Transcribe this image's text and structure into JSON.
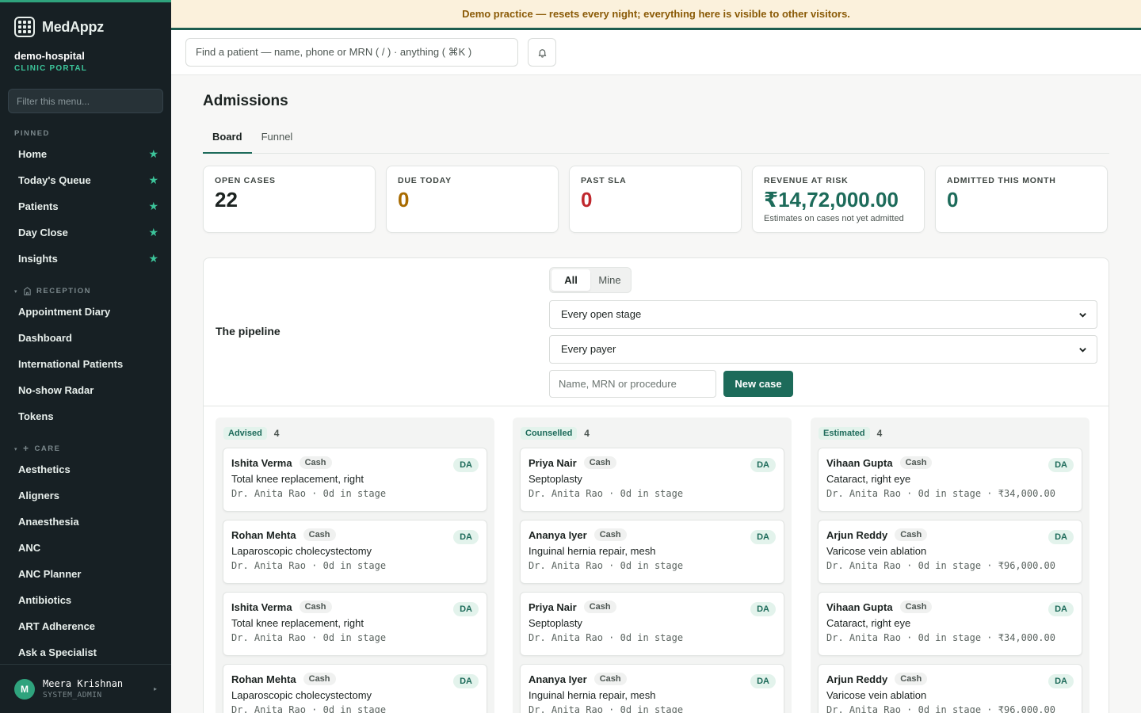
{
  "brand": {
    "name": "MedAppz"
  },
  "org": {
    "name": "demo-hospital",
    "portal": "CLINIC PORTAL"
  },
  "sidebar": {
    "filter_placeholder": "Filter this menu...",
    "pinned_label": "PINNED",
    "pinned": [
      {
        "label": "Home"
      },
      {
        "label": "Today's Queue"
      },
      {
        "label": "Patients"
      },
      {
        "label": "Day Close"
      },
      {
        "label": "Insights"
      }
    ],
    "reception_label": "RECEPTION",
    "reception": [
      {
        "label": "Appointment Diary"
      },
      {
        "label": "Dashboard"
      },
      {
        "label": "International Patients"
      },
      {
        "label": "No-show Radar"
      },
      {
        "label": "Tokens"
      }
    ],
    "care_label": "CARE",
    "care": [
      {
        "label": "Aesthetics"
      },
      {
        "label": "Aligners"
      },
      {
        "label": "Anaesthesia"
      },
      {
        "label": "ANC"
      },
      {
        "label": "ANC Planner"
      },
      {
        "label": "Antibiotics"
      },
      {
        "label": "ART Adherence"
      },
      {
        "label": "Ask a Specialist"
      }
    ],
    "user": {
      "initial": "M",
      "name": "Meera Krishnan",
      "role": "SYSTEM_ADMIN"
    }
  },
  "banner": {
    "text": "Demo practice — resets every night; everything here is visible to other visitors."
  },
  "header": {
    "search_placeholder": "Find a patient — name, phone or MRN ( / ) · anything ( ⌘K )"
  },
  "page": {
    "title": "Admissions",
    "tabs": [
      {
        "label": "Board"
      },
      {
        "label": "Funnel"
      }
    ]
  },
  "stats": [
    {
      "label": "OPEN CASES",
      "value": "22",
      "color": "#1c2321"
    },
    {
      "label": "DUE TODAY",
      "value": "0",
      "color": "#a86b00"
    },
    {
      "label": "PAST SLA",
      "value": "0",
      "color": "#c0282e"
    },
    {
      "label": "REVENUE AT RISK",
      "value": "₹14,72,000.00",
      "note": "Estimates on cases not yet admitted",
      "color": "#1d6b5a"
    },
    {
      "label": "ADMITTED THIS MONTH",
      "value": "0",
      "color": "#1d6b5a"
    }
  ],
  "pipeline": {
    "title": "The pipeline",
    "scope_options": [
      {
        "label": "All"
      },
      {
        "label": "Mine"
      }
    ],
    "stage_select": "Every open stage",
    "payer_select": "Every payer",
    "case_search_placeholder": "Name, MRN or procedure",
    "new_case_label": "New case",
    "columns": [
      {
        "stage": "Advised",
        "count": "4",
        "cards": [
          {
            "name": "Ishita Verma",
            "payer": "Cash",
            "badge": "DA",
            "procedure": "Total knee replacement, right",
            "meta": "Dr. Anita Rao · 0d in stage"
          },
          {
            "name": "Rohan Mehta",
            "payer": "Cash",
            "badge": "DA",
            "procedure": "Laparoscopic cholecystectomy",
            "meta": "Dr. Anita Rao · 0d in stage"
          },
          {
            "name": "Ishita Verma",
            "payer": "Cash",
            "badge": "DA",
            "procedure": "Total knee replacement, right",
            "meta": "Dr. Anita Rao · 0d in stage"
          },
          {
            "name": "Rohan Mehta",
            "payer": "Cash",
            "badge": "DA",
            "procedure": "Laparoscopic cholecystectomy",
            "meta": "Dr. Anita Rao · 0d in stage"
          }
        ]
      },
      {
        "stage": "Counselled",
        "count": "4",
        "cards": [
          {
            "name": "Priya Nair",
            "payer": "Cash",
            "badge": "DA",
            "procedure": "Septoplasty",
            "meta": "Dr. Anita Rao · 0d in stage"
          },
          {
            "name": "Ananya Iyer",
            "payer": "Cash",
            "badge": "DA",
            "procedure": "Inguinal hernia repair, mesh",
            "meta": "Dr. Anita Rao · 0d in stage"
          },
          {
            "name": "Priya Nair",
            "payer": "Cash",
            "badge": "DA",
            "procedure": "Septoplasty",
            "meta": "Dr. Anita Rao · 0d in stage"
          },
          {
            "name": "Ananya Iyer",
            "payer": "Cash",
            "badge": "DA",
            "procedure": "Inguinal hernia repair, mesh",
            "meta": "Dr. Anita Rao · 0d in stage"
          }
        ]
      },
      {
        "stage": "Estimated",
        "count": "4",
        "cards": [
          {
            "name": "Vihaan Gupta",
            "payer": "Cash",
            "badge": "DA",
            "procedure": "Cataract, right eye",
            "meta": "Dr. Anita Rao · 0d in stage · ₹34,000.00"
          },
          {
            "name": "Arjun Reddy",
            "payer": "Cash",
            "badge": "DA",
            "procedure": "Varicose vein ablation",
            "meta": "Dr. Anita Rao · 0d in stage · ₹96,000.00"
          },
          {
            "name": "Vihaan Gupta",
            "payer": "Cash",
            "badge": "DA",
            "procedure": "Cataract, right eye",
            "meta": "Dr. Anita Rao · 0d in stage · ₹34,000.00"
          },
          {
            "name": "Arjun Reddy",
            "payer": "Cash",
            "badge": "DA",
            "procedure": "Varicose vein ablation",
            "meta": "Dr. Anita Rao · 0d in stage · ₹96,000.00"
          }
        ]
      }
    ]
  }
}
